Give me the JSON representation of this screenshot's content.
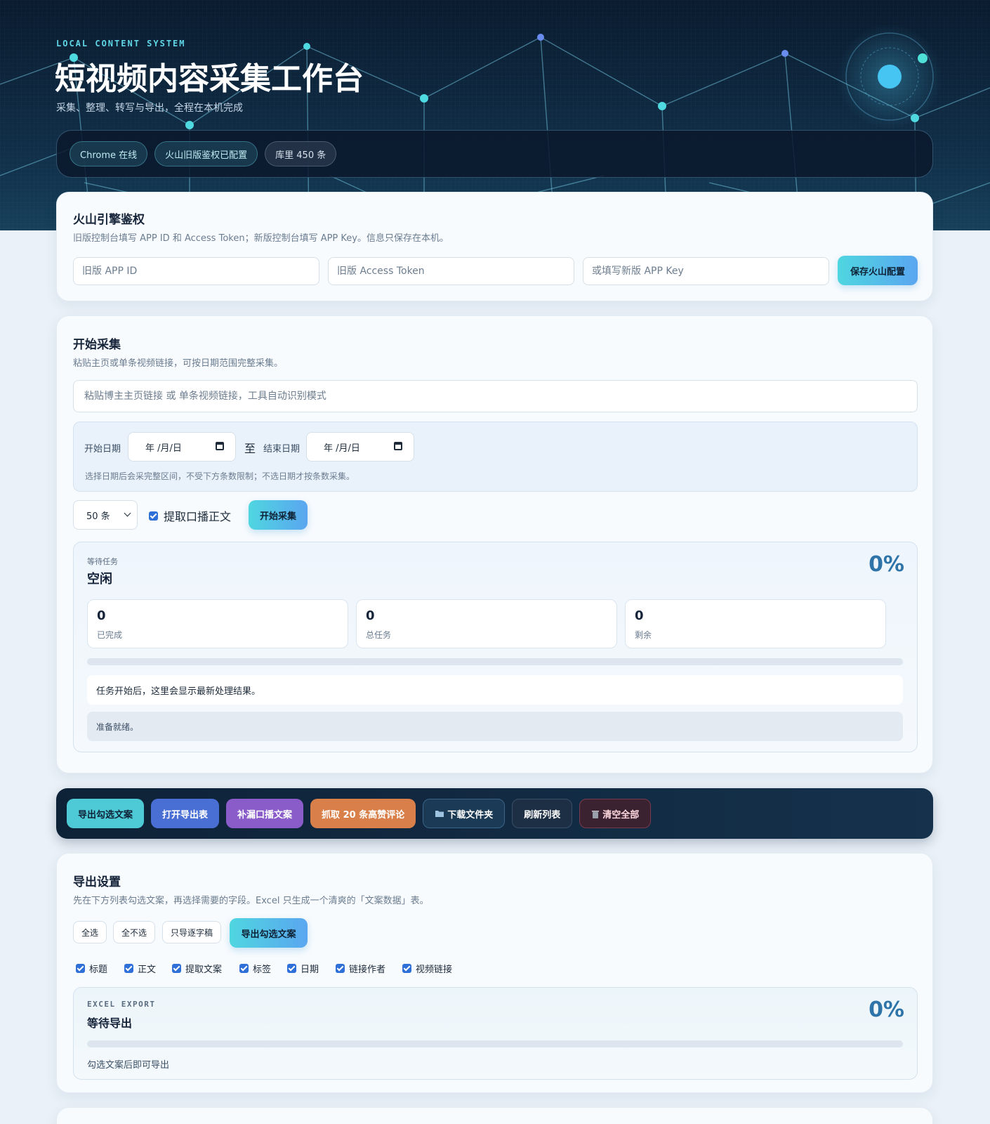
{
  "hero": {
    "eyebrow": "LOCAL CONTENT SYSTEM",
    "title": "短视频内容采集工作台",
    "subtitle": "采集、整理、转写与导出，全程在本机完成",
    "status_pills": [
      "Chrome 在线",
      "火山旧版鉴权已配置",
      "库里 450 条"
    ]
  },
  "auth": {
    "title": "火山引擎鉴权",
    "desc": "旧版控制台填写 APP ID 和 Access Token；新版控制台填写 APP Key。信息只保存在本机。",
    "app_id_placeholder": "旧版 APP ID",
    "token_placeholder": "旧版 Access Token",
    "appkey_placeholder": "或填写新版 APP Key",
    "save_label": "保存火山配置"
  },
  "collect": {
    "title": "开始采集",
    "desc": "粘贴主页或单条视频链接，可按日期范围完整采集。",
    "url_placeholder": "粘贴博主主页链接 或 单条视频链接，工具自动识别模式",
    "start_date_label": "开始日期",
    "start_date_value": "年 /月/日",
    "separator": "至",
    "end_date_label": "结束日期",
    "end_date_value": "年 /月/日",
    "date_hint": "选择日期后会采完整区间，不受下方条数限制；不选日期才按条数采集。",
    "count_value": "50 条",
    "extract_label": "提取口播正文",
    "start_label": "开始采集",
    "task": {
      "kicker": "等待任务",
      "state": "空闲",
      "percent": "0%",
      "progress": 0,
      "stats": [
        {
          "value": "0",
          "label": "已完成"
        },
        {
          "value": "0",
          "label": "总任务"
        },
        {
          "value": "0",
          "label": "剩余"
        }
      ],
      "result_msg": "任务开始后，这里会显示最新处理结果。",
      "log_msg": "准备就绪。"
    }
  },
  "toolbar": {
    "buttons": [
      {
        "label": "导出勾选文案",
        "color": "#4ec9d6"
      },
      {
        "label": "打开导出表",
        "color": "#4a6fd4"
      },
      {
        "label": "补漏口播文案",
        "color": "#8a5cc9"
      },
      {
        "label": "抓取 20 条高赞评论",
        "color": "#d9804a"
      },
      {
        "label": "下载文件夹",
        "icon": "folder-icon"
      },
      {
        "label": "刷新列表"
      },
      {
        "label": "清空全部",
        "icon": "trash-icon"
      }
    ]
  },
  "export": {
    "title": "导出设置",
    "desc": "先在下方列表勾选文案，再选择需要的字段。Excel 只生成一个清爽的「文案数据」表。",
    "select_all": "全选",
    "select_none": "全不选",
    "subtitle_only": "只导逐字稿",
    "export_label": "导出勾选文案",
    "fields": [
      "标题",
      "正文",
      "提取文案",
      "标签",
      "日期",
      "链接作者",
      "视频链接"
    ],
    "panel": {
      "kicker": "EXCEL EXPORT",
      "state": "等待导出",
      "percent": "0%",
      "progress": 0,
      "hint": "勾选文案后即可导出"
    }
  }
}
